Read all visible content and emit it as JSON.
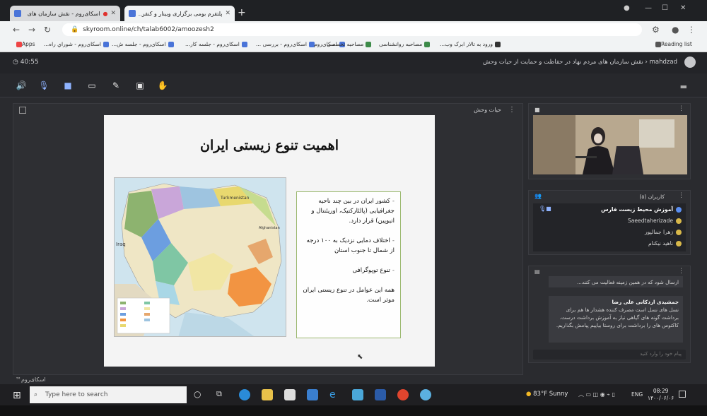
{
  "browser": {
    "tabs": [
      {
        "title": "اسکای‌روم - نقش سازمان های",
        "active": false
      },
      {
        "title": "پلتفرم بومی برگزاری وبینار و کنفر...",
        "active": true
      }
    ],
    "url": "skyroom.online/ch/talab6002/amoozesh2",
    "bookmarks": [
      "Apps",
      "اسکای‌روم - شوراي راه...",
      "اسکای‌روم - جلسه ش...",
      "اسکای‌روم - جلسه کار...",
      "اسکای‌روم - بررسی ...",
      "اسکای‌روم",
      "مصاحبه تخصصی",
      "مصاحبه روانشناسی",
      "ورود به تالار ابرک وب...",
      "Reading list"
    ]
  },
  "app": {
    "timer": "40:55",
    "breadcrumb": "mahdzad ‹ نقش سازمان های مردم نهاد در حفاظت و حمایت از حیات وحش",
    "stage_title": "حیات وحش",
    "users_panel_title": "کاربران (۵)",
    "users": [
      {
        "name": "آموزش محیط زیست فارس",
        "role": "presenter"
      },
      {
        "name": "Saeedtaherizade",
        "role": "user"
      },
      {
        "name": "زهرا جمالپور",
        "role": "user"
      },
      {
        "name": "ناهید نیکنام",
        "role": "user"
      }
    ],
    "chat_messages": [
      {
        "author": "",
        "text": "ارسال شود که در همین زمینه فعالیت می کنند..."
      },
      {
        "author": "جمشیدی اردکانی علی رضا",
        "text": "نسل های نسل است مصرف کننده هشدار ها هم برای برداشت گونه های گیاهی نیاز به آموزش برداشت درست. کاکتوس های را برداشت برای روستا بیاییم پیامش بگذاریم."
      }
    ],
    "chat_placeholder": "پیام خود را وارد کنید",
    "brand": "اسکای‌روم™"
  },
  "slide": {
    "title": "اهمیت تنوع زیستی ایران",
    "bullets": [
      "کشور ایران در بین چند ناحیه جغرافیایی (پالئارکتیک، اوریئنتال و اتیوپین) قرار دارد.",
      "اختلاف دمایی نزدیک به ۱۰۰ درجه از شمال تا جنوب استان",
      "تنوع توپوگرافی"
    ],
    "footer": "همه این عوامل در تنوع زیستی ایران موثر است.",
    "map_labels": [
      "Turkmenistan",
      "Iraq",
      "Afghanistan"
    ]
  },
  "taskbar": {
    "search_placeholder": "Type here to search",
    "weather": "83°F  Sunny",
    "lang": "ENG",
    "time": "08:29",
    "date": "۱۴۰۰/۰۶/۰۶"
  },
  "colors": {
    "accent": "#8fb3ff",
    "slide_box_border": "#9bb86f"
  }
}
